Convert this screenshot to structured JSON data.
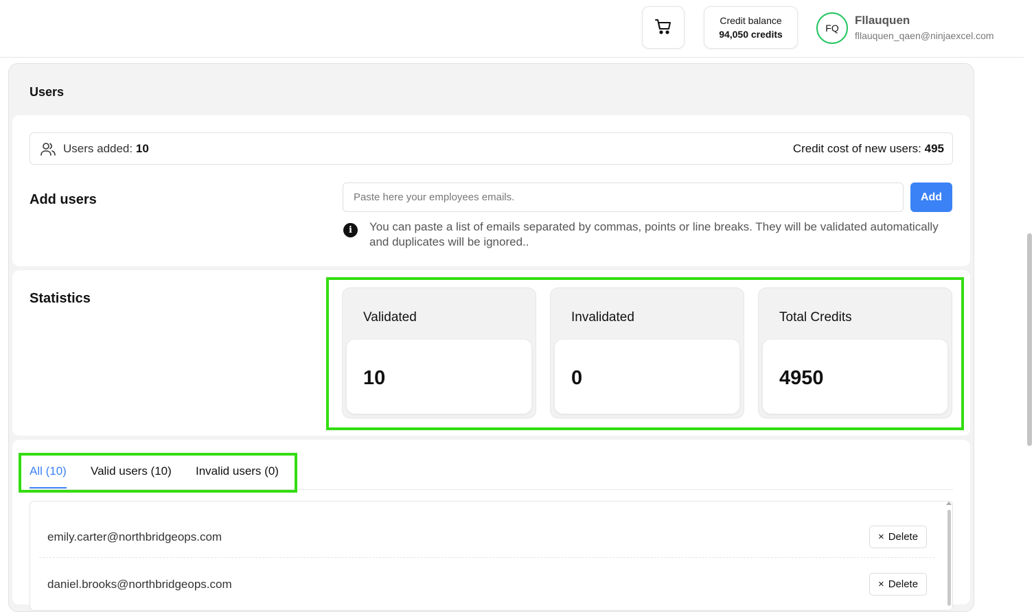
{
  "header": {
    "cart_icon": "cart-icon",
    "credit_balance_label": "Credit balance",
    "credit_balance_value": "94,050 credits",
    "avatar_initials": "FQ",
    "user_name": "Fllauquen",
    "user_email": "fllauquen_qaen@ninjaexcel.com"
  },
  "page": {
    "title": "Users"
  },
  "summary": {
    "icon": "users-icon",
    "users_added_label": "Users added:",
    "users_added_value": "10",
    "credit_cost_label": "Credit cost of new users:",
    "credit_cost_value": "495"
  },
  "add_users": {
    "label": "Add users",
    "placeholder": "Paste here your employees emails.",
    "button": "Add",
    "info_icon": "info-icon",
    "info_text": "You can paste a list of emails separated by commas, points or line breaks. They will be validated automatically and duplicates will be ignored.."
  },
  "statistics": {
    "label": "Statistics",
    "cards": [
      {
        "title": "Validated",
        "value": "10"
      },
      {
        "title": "Invalidated",
        "value": "0"
      },
      {
        "title": "Total Credits",
        "value": "4950"
      }
    ]
  },
  "tabs": [
    {
      "label": "All (10)",
      "active": true
    },
    {
      "label": "Valid users (10)",
      "active": false
    },
    {
      "label": "Invalid users (0)",
      "active": false
    }
  ],
  "users_list": [
    {
      "email": "emily.carter@northbridgeops.com",
      "delete_label": "Delete"
    },
    {
      "email": "daniel.brooks@northbridgeops.com",
      "delete_label": "Delete"
    }
  ],
  "colors": {
    "accent": "#3b82f6",
    "highlight": "#33dd11",
    "avatar_ring": "#22c55e"
  }
}
